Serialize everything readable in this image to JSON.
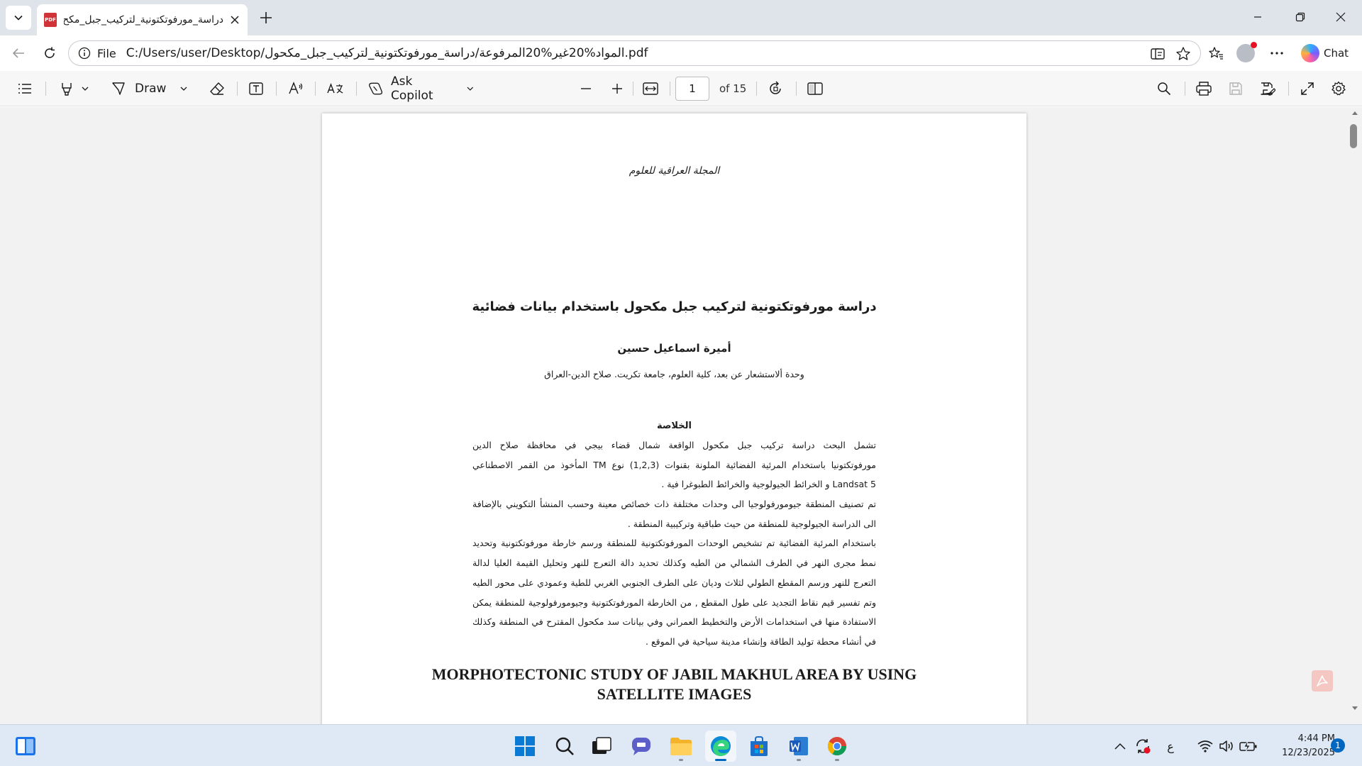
{
  "browser": {
    "tab_title": "دراسة_مورفوتكتونية_لتركيب_جبل_مكح",
    "chat_label": "Chat"
  },
  "address": {
    "scheme_label": "File",
    "url": "C:/Users/user/Desktop/المواد%20غير%20المرفوعة/دراسة_مورفوتكتونية_لتركيب_جبل_مكحول.pdf"
  },
  "pdf_toolbar": {
    "draw_label": "Draw",
    "copilot_label": "Ask Copilot",
    "page_current": "1",
    "page_total_label": "of 15"
  },
  "document": {
    "journal": "المجلة العراقية للعلوم",
    "title_ar": "دراسة  مورفوتكتونية  لتركيب جبل مكحول باستخدام بيانات فضائية",
    "author": "أميرة اسماعيل حسين",
    "affiliation": "وحدة ألاستشعار عن بعد، كلية العلوم، جامعة تكريت. صلاح الدين-العراق",
    "abstract_heading": "الخلاصة",
    "abstract_lines": [
      "تشمل البحث دراسة تركيب جبل مكحول  الواقعة شمال قضاء بيجي في محافظة صلاح الدين",
      "مورفوتكتونيا باستخدام المرئية الفضائية الملونة بقنوات (1,2,3) نوع  TM المأخوذ من القمر الاصطناعي",
      "Landsat 5  و الخرائط الجيولوجية والخرائط الطبوغرا فية .",
      "تم تصنيف المنطقة جيومورفولوجيا الى وحدات مختلفة ذات خصائص معينة وحسب المنشأ التكويني بالإضافة",
      "الى الدراسة الجيولوجية للمنطقة من حيث طباقية وتركيبية المنطقة .",
      "باستخدام المرئية الفضائية تم تشخيص الوحدات المورفوتكتونية للمنطقة ورسم خارطة مورفوتكتونية وتحديد",
      "نمط مجرى  النهر في الطرف الشمالي من الطيه  وكذلك تحديد دالة التعرج للنهر وتحليل القيمة العليا لدالة",
      "التعرج للنهر ورسم المقطع الطولي لثلاث وديان على الطرف الجنوبي الغربي للطية وعمودي على محور الطيه",
      "وتم تفسير قيم نقاط التجديد على طول المقطع  , من الخارطة المورفوتكتونية وجيومورفولوجية للمنطقة يمكن",
      "الاستفادة منها في استخدامات الأرض والتخطيط العمراني وفي بيانات سد مكحول المقترح في المنطقة وكذلك",
      "في أنشاء محطة توليد الطاقة وإنشاء مدينة سياحية في الموقع ."
    ],
    "title_en_line1": "MORPHOTECTONIC STUDY OF  JABIL MAKHUL  AREA BY USING",
    "title_en_line2": "SATELLITE IMAGES"
  },
  "taskbar": {
    "lang_indicator": "ع",
    "time": "4:44 PM",
    "date": "12/23/2025",
    "notification_count": "1"
  },
  "colors": {
    "edge_active_blue": "#0067c0",
    "pdf_red": "#d13438",
    "taskbar_bg": "#dfe9f5"
  }
}
